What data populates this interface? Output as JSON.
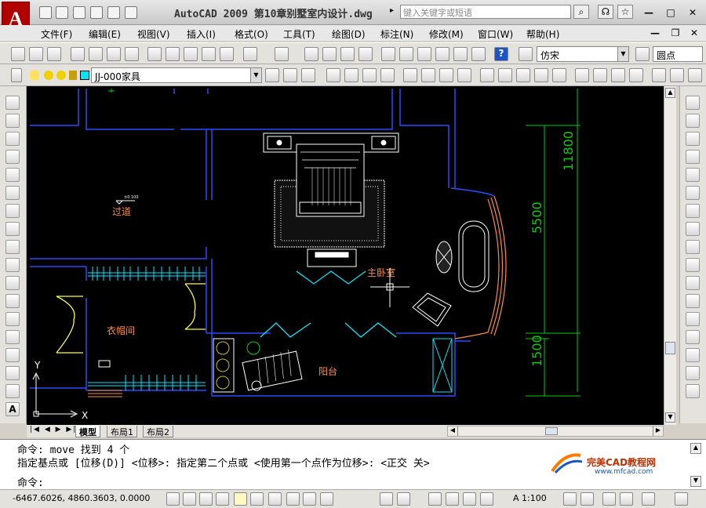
{
  "titlebar": {
    "logo": "A",
    "title": "AutoCAD 2009  第10章别墅室内设计.dwg",
    "search_placeholder": "键入关键字或短语",
    "arrow": "▸"
  },
  "menu": [
    "文件(F)",
    "编辑(E)",
    "视图(V)",
    "插入(I)",
    "格式(O)",
    "工具(T)",
    "绘图(D)",
    "标注(N)",
    "修改(M)",
    "窗口(W)",
    "帮助(H)"
  ],
  "toolbar": {
    "text_style": "仿宋",
    "dim_style": "圆点",
    "layer": "JJ-000家具"
  },
  "drawing": {
    "labels": {
      "corridor": "过道",
      "wardrobe": "衣帽间",
      "master": "主卧室",
      "balcony": "阳台",
      "level": "±0.100"
    },
    "dims": {
      "d1": "11800",
      "d2": "5500",
      "d3": "1500"
    },
    "axis_x": "X",
    "axis_y": "Y"
  },
  "tabs": [
    "模型",
    "布局1",
    "布局2"
  ],
  "command": {
    "line1": "命令:  move 找到 4 个",
    "line2": "指定基点或 [位移(D)] <位移>:  指定第二个点或 <使用第一个点作为位移>:  <正交 关>",
    "prompt": "命令:"
  },
  "watermark": {
    "name": "完美CAD教程网",
    "url": "www.mfcad.com"
  },
  "status": {
    "coords": "-6467.6026, 4860.3603, 0.0000",
    "scale": "A 1:100"
  },
  "colors": {
    "canvas": "#000000",
    "wall": "#2a4bff",
    "cyan": "#00e5ff",
    "white": "#ffffff",
    "green": "#00d000",
    "orange": "#ff8c3a",
    "yellow": "#ffff40"
  }
}
